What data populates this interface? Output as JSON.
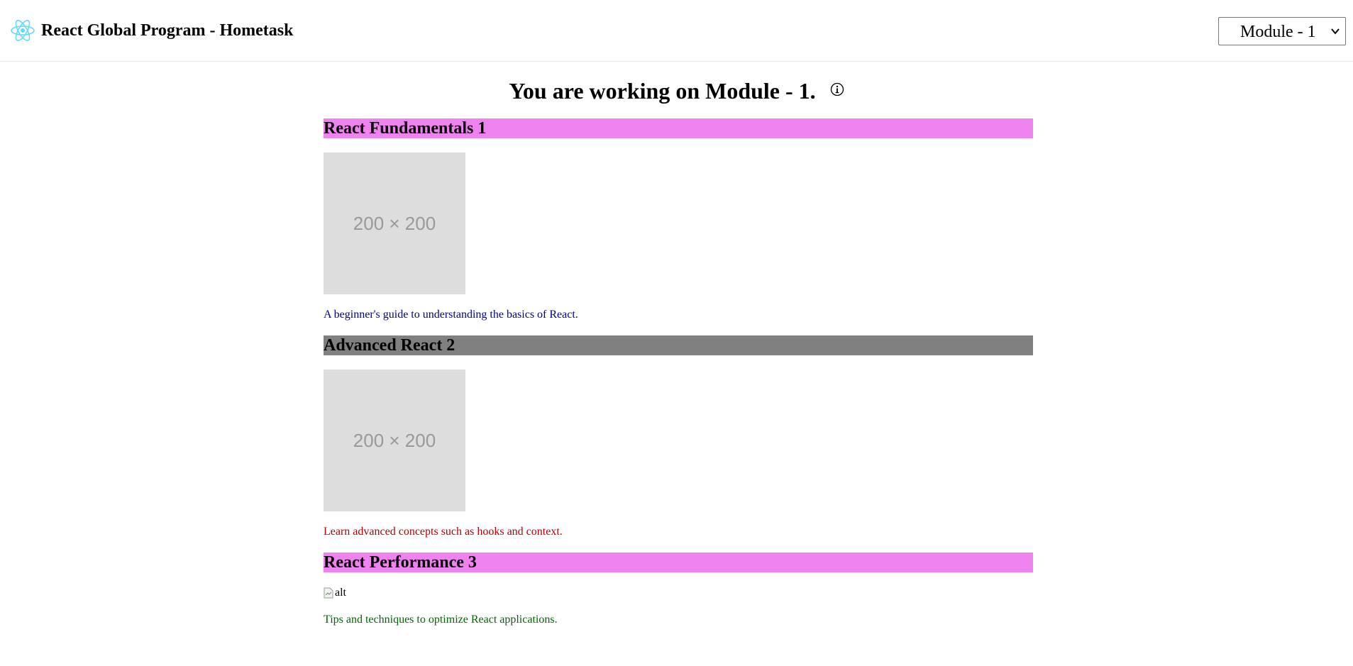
{
  "header": {
    "logo_icon": "react-atom-icon",
    "logo_color": "#61dafb",
    "title": "React Global Program - Hometask",
    "module_select": {
      "selected": "Module - 1",
      "icon": "chevron-down-icon"
    }
  },
  "main": {
    "title": "You are working on Module - 1.",
    "info_icon": "info-circle-icon"
  },
  "courses": [
    {
      "title": "React Fundamentals 1",
      "heading_color": "#ee82ee",
      "image_label": "200 × 200",
      "description": "A beginner's guide to understanding the basics of React.",
      "description_color": "#00008b"
    },
    {
      "title": "Advanced React 2",
      "heading_color": "#808080",
      "image_label": "200 × 200",
      "description": "Learn advanced concepts such as hooks and context.",
      "description_color": "#b00000"
    },
    {
      "title": "React Performance 3",
      "heading_color": "#ee82ee",
      "image_alt": "alt",
      "description": "Tips and techniques to optimize React applications.",
      "description_color": "#006400"
    }
  ]
}
